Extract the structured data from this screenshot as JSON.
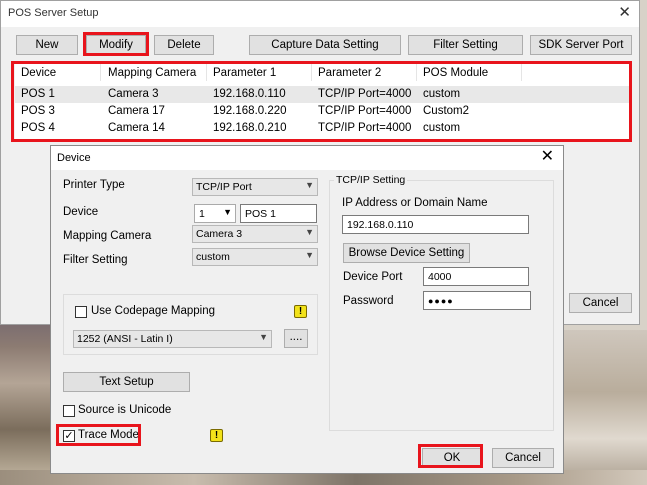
{
  "main_window": {
    "title": "POS Server Setup",
    "close_glyph": "✕",
    "toolbar": {
      "new_label": "New",
      "modify_label": "Modify",
      "delete_label": "Delete",
      "capture_label": "Capture Data Setting",
      "filter_label": "Filter Setting",
      "sdk_label": "SDK Server Port"
    },
    "table": {
      "columns": [
        "Device",
        "Mapping Camera",
        "Parameter 1",
        "Parameter 2",
        "POS Module"
      ],
      "rows": [
        [
          "POS 1",
          "Camera 3",
          "192.168.0.110",
          "TCP/IP Port=4000",
          "custom"
        ],
        [
          "POS 3",
          "Camera 17",
          "192.168.0.220",
          "TCP/IP Port=4000",
          "Custom2"
        ],
        [
          "POS 4",
          "Camera 14",
          "192.168.0.210",
          "TCP/IP Port=4000",
          "custom"
        ]
      ]
    },
    "cancel_label": "Cancel"
  },
  "device_dialog": {
    "title": "Device",
    "close_glyph": "✕",
    "printer_type_label": "Printer Type",
    "printer_type_value": "TCP/IP Port",
    "device_label": "Device",
    "device_number_value": "1",
    "device_name_value": "POS 1",
    "mapping_camera_label": "Mapping Camera",
    "mapping_camera_value": "Camera 3",
    "filter_setting_label": "Filter Setting",
    "filter_setting_value": "custom",
    "use_codepage_label": "Use Codepage Mapping",
    "codepage_value": "1252  (ANSI - Latin I)",
    "codepage_browse_label": "....",
    "text_setup_label": "Text Setup",
    "source_unicode_label": "Source is Unicode",
    "trace_mode_label": "Trace Mode",
    "trace_mode_checked": "✓",
    "tcpip_group_title": "TCP/IP Setting",
    "ip_label": "IP Address or Domain Name",
    "ip_value": "192.168.0.110",
    "browse_device_label": "Browse Device Setting",
    "device_port_label": "Device Port",
    "device_port_value": "4000",
    "password_label": "Password",
    "password_value": "●●●●",
    "ok_label": "OK",
    "cancel_label": "Cancel",
    "warning_glyph": "!"
  },
  "colors": {
    "highlight_box": "#e8141c",
    "warning_icon": "#f2e21a"
  }
}
